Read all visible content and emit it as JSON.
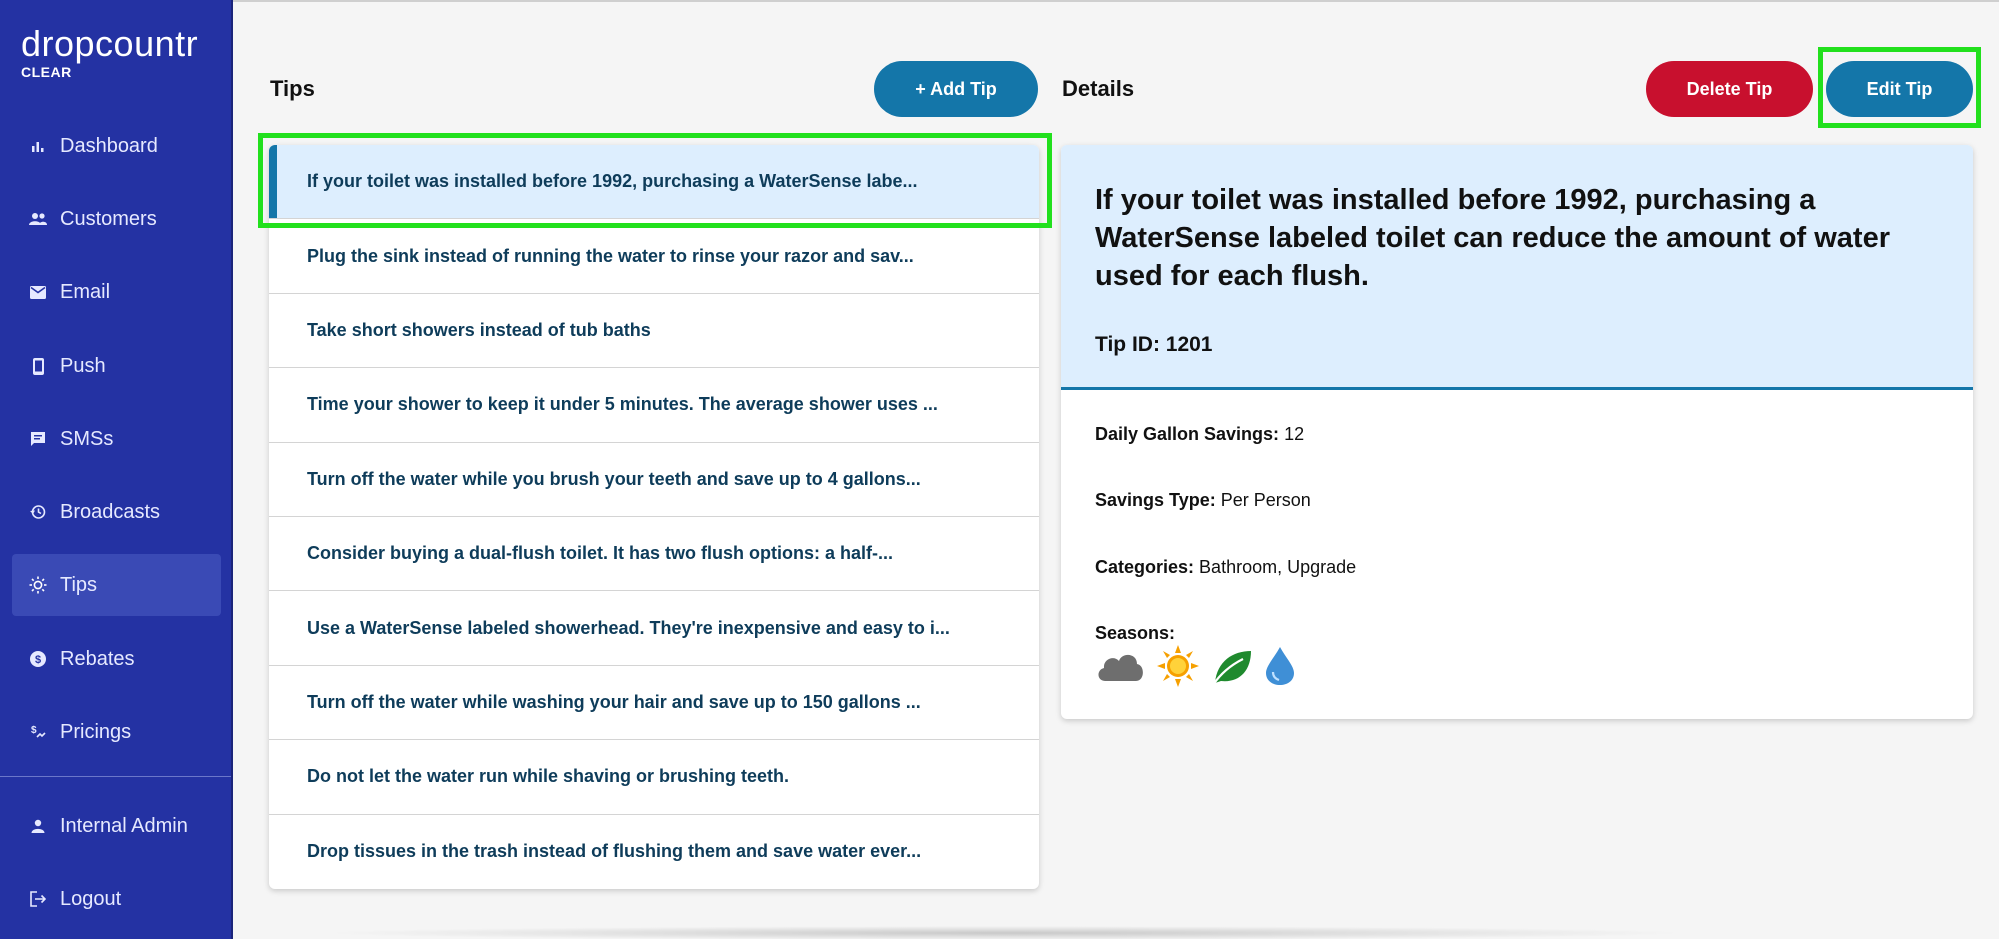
{
  "brand": {
    "name": "dropcountr",
    "sub": "CLEAR"
  },
  "sidebar": {
    "items": [
      {
        "label": "Dashboard",
        "icon": "bar-chart-icon"
      },
      {
        "label": "Customers",
        "icon": "people-icon"
      },
      {
        "label": "Email",
        "icon": "envelope-icon"
      },
      {
        "label": "Push",
        "icon": "phone-icon"
      },
      {
        "label": "SMSs",
        "icon": "chat-icon"
      },
      {
        "label": "Broadcasts",
        "icon": "history-icon"
      },
      {
        "label": "Tips",
        "icon": "sun-icon"
      },
      {
        "label": "Rebates",
        "icon": "dollar-icon"
      },
      {
        "label": "Pricings",
        "icon": "pricing-icon"
      }
    ],
    "bottom_items": [
      {
        "label": "Internal Admin",
        "icon": "person-icon"
      },
      {
        "label": "Logout",
        "icon": "logout-icon"
      }
    ],
    "active": "Tips"
  },
  "tips_panel": {
    "title": "Tips",
    "add_label": "+ Add Tip"
  },
  "tips": [
    "If your toilet was installed before 1992, purchasing a WaterSense labe...",
    "Plug the sink instead of running the water to rinse your razor and sav...",
    "Take short showers instead of tub baths",
    "Time your shower to keep it under 5 minutes. The average shower uses ...",
    "Turn off the water while you brush your teeth and save up to 4 gallons...",
    "Consider buying a dual-flush toilet. It has two flush options: a half-...",
    "Use a WaterSense labeled showerhead. They're inexpensive and easy to i...",
    "Turn off the water while washing your hair and save up to 150 gallons ...",
    "Do not let the water run while shaving or brushing teeth.",
    "Drop tissues in the trash instead of flushing them and save water ever..."
  ],
  "details_panel": {
    "title": "Details",
    "delete_label": "Delete Tip",
    "edit_label": "Edit Tip",
    "tip_title": "If your toilet was installed before 1992, purchasing a WaterSense labeled toilet can reduce the amount of water used for each flush.",
    "tip_id_label": "Tip ID: 1201",
    "daily_label": "Daily Gallon Savings:",
    "daily_value": "12",
    "savings_type_label": "Savings Type:",
    "savings_type_value": "Per Person",
    "categories_label": "Categories:",
    "categories_value": "Bathroom,  Upgrade",
    "seasons_label": "Seasons:",
    "seasons": [
      "cloud-icon",
      "sun-icon",
      "leaf-icon",
      "water-drop-icon"
    ]
  },
  "colors": {
    "sidebar_bg": "#2432a3",
    "accent_blue": "#1476a9",
    "danger_red": "#c8102e",
    "selected_bg": "#ddeefe",
    "highlight_green": "#22e01d"
  }
}
